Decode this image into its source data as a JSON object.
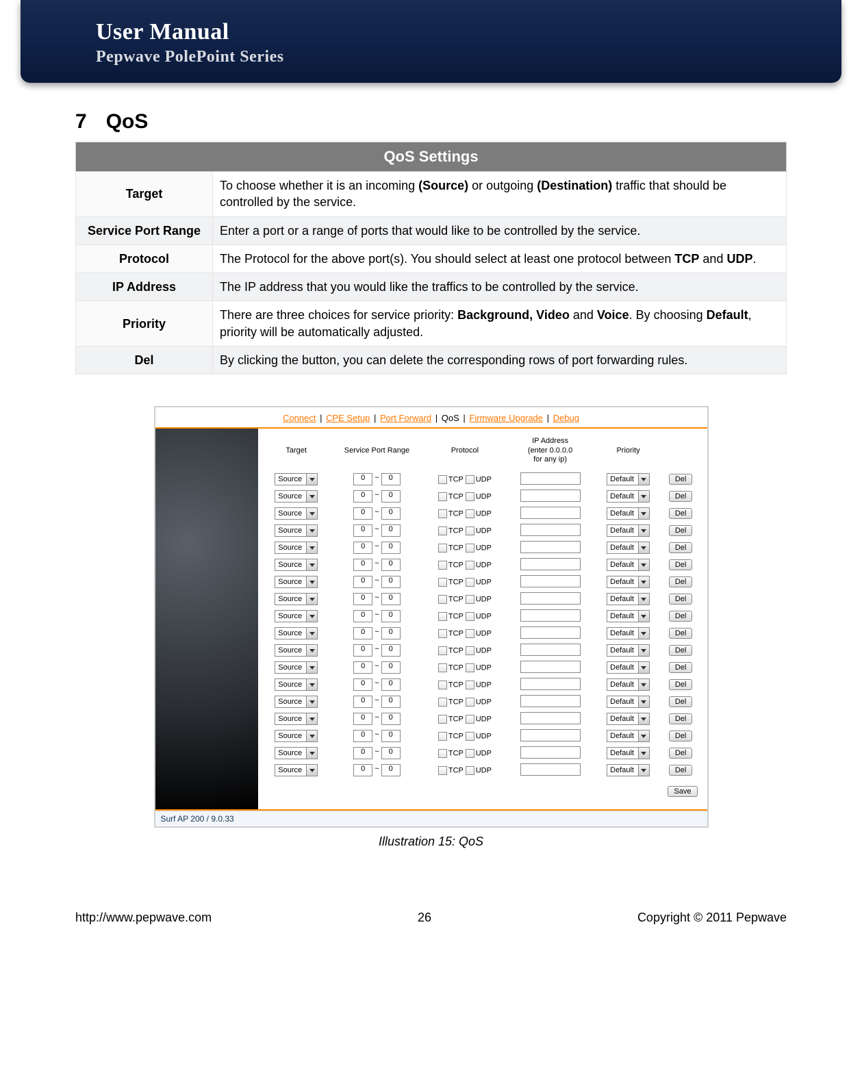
{
  "banner": {
    "title": "User Manual",
    "subtitle": "Pepwave PolePoint Series"
  },
  "section": {
    "num": "7",
    "title": "QoS"
  },
  "spec": {
    "header": "QoS Settings",
    "rows": [
      {
        "label": "Target",
        "html": "To choose whether it is an incoming <b>(Source)</b> or outgoing <b>(Destination)</b> traffic that should be controlled by the service."
      },
      {
        "label": "Service Port Range",
        "html": "Enter a port or a range of ports that would like to be controlled by the service."
      },
      {
        "label": "Protocol",
        "html": "The Protocol for the above port(s). You should select at least one protocol between <b>TCP</b> and <b>UDP</b>."
      },
      {
        "label": "IP Address",
        "html": "The IP address that you would like the traffics to be controlled by the service."
      },
      {
        "label": "Priority",
        "html": "There are three choices for service priority: <b>Background, Video</b> and <b>Voice</b>. By choosing <b>Default</b>, priority will be automatically adjusted."
      },
      {
        "label": "Del",
        "html": "By clicking the button, you can delete the corresponding rows of port forwarding rules."
      }
    ]
  },
  "illus": {
    "caption": "Illustration 15: QoS",
    "nav": {
      "items": [
        "Connect",
        "CPE Setup",
        "Port Forward",
        "QoS",
        "Firmware Upgrade",
        "Debug"
      ],
      "current": "QoS",
      "sep": "|"
    },
    "grid": {
      "headers": {
        "target": "Target",
        "port": "Service Port Range",
        "protocol": "Protocol",
        "ip": "IP Address\n(enter 0.0.0.0\nfor any ip)",
        "priority": "Priority",
        "del": ""
      },
      "defaults": {
        "target": "Source",
        "port_from": "0",
        "port_to": "0",
        "tcp_label": "TCP",
        "udp_label": "UDP",
        "ip": "",
        "priority": "Default",
        "del_label": "Del"
      },
      "row_count": 18,
      "save_label": "Save"
    },
    "status": "Surf AP 200 / 9.0.33"
  },
  "footer": {
    "left": "http://www.pepwave.com",
    "center": "26",
    "right": "Copyright © 2011 Pepwave"
  }
}
